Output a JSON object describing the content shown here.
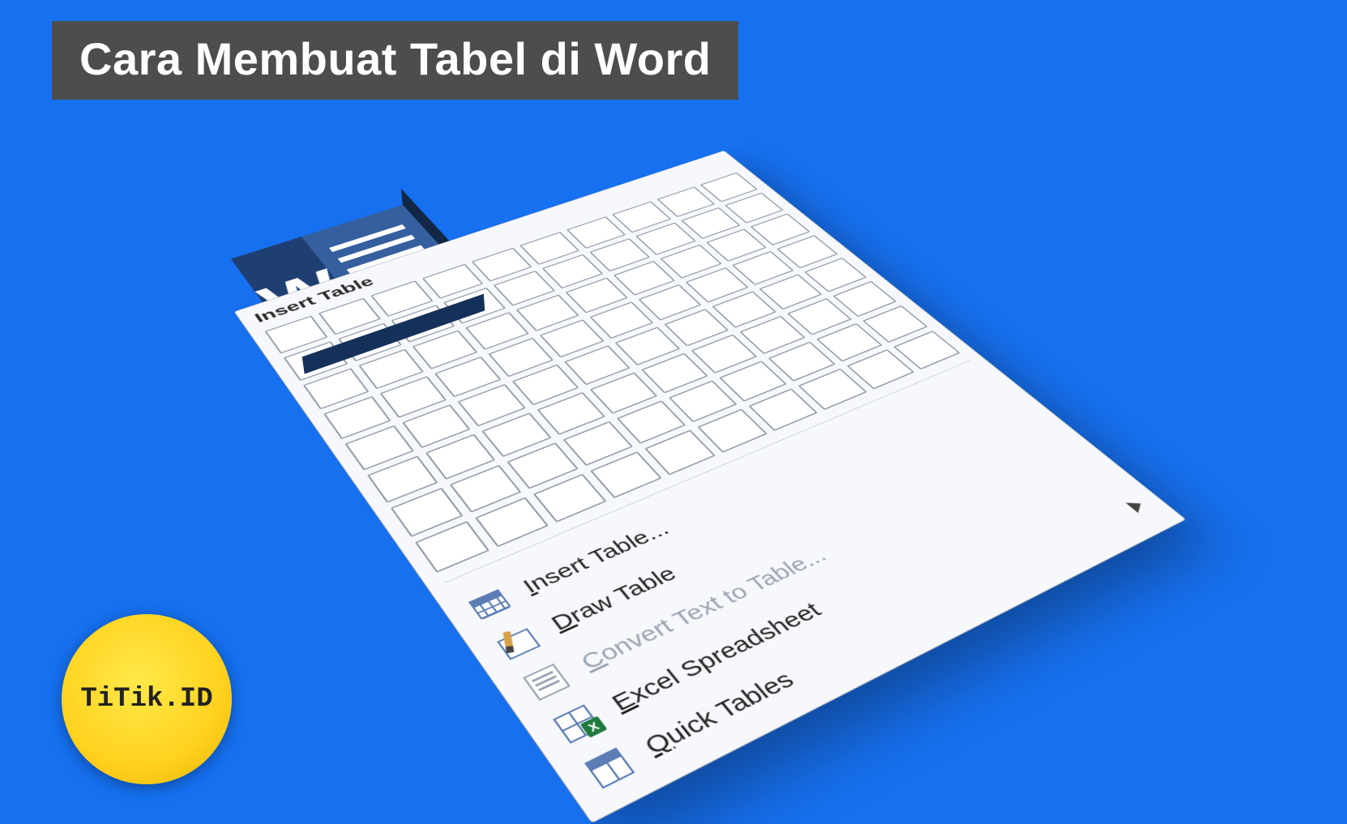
{
  "title": "Cara Membuat Tabel di Word",
  "brand": "TiTik.ID",
  "word_icon_letter": "W",
  "panel": {
    "header": "Insert Table",
    "grid": {
      "rows": 8,
      "cols": 10
    },
    "menu": [
      {
        "id": "insert-table",
        "label": "Insert Table...",
        "icon": "table-grid-icon",
        "disabled": false,
        "submenu": false
      },
      {
        "id": "draw-table",
        "label": "Draw Table",
        "icon": "draw-table-icon",
        "disabled": false,
        "submenu": false
      },
      {
        "id": "convert-text",
        "label": "Convert Text to Table...",
        "icon": "convert-text-icon",
        "disabled": true,
        "submenu": false
      },
      {
        "id": "excel-sheet",
        "label": "Excel Spreadsheet",
        "icon": "excel-icon",
        "disabled": false,
        "submenu": false
      },
      {
        "id": "quick-tables",
        "label": "Quick Tables",
        "icon": "quick-tables-icon",
        "disabled": false,
        "submenu": true
      }
    ]
  },
  "colors": {
    "background": "#1670f0",
    "banner": "#4d4d4d",
    "word_dark": "#1f3f73",
    "word_light": "#355f9e",
    "badge": "#ffd21f"
  }
}
